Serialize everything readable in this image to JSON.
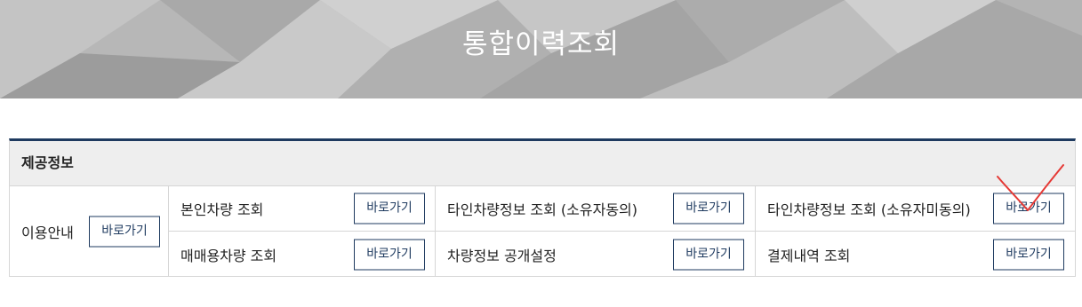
{
  "banner": {
    "title": "통합이력조회"
  },
  "table": {
    "header": "제공정보",
    "usage": {
      "label": "이용안내",
      "button": "바로가기"
    },
    "rows": [
      [
        {
          "label": "본인차량 조회",
          "button": "바로가기"
        },
        {
          "label": "타인차량정보 조회 (소유자동의)",
          "button": "바로가기"
        },
        {
          "label": "타인차량정보 조회 (소유자미동의)",
          "button": "바로가기"
        }
      ],
      [
        {
          "label": "매매용차량 조회",
          "button": "바로가기"
        },
        {
          "label": "차량정보 공개설정",
          "button": "바로가기"
        },
        {
          "label": "결제내역 조회",
          "button": "바로가기"
        }
      ]
    ]
  },
  "colors": {
    "accent": "#1e3a5f",
    "border": "#d6d6d6",
    "header_bg": "#eeeeee",
    "annotation": "#e53935"
  }
}
